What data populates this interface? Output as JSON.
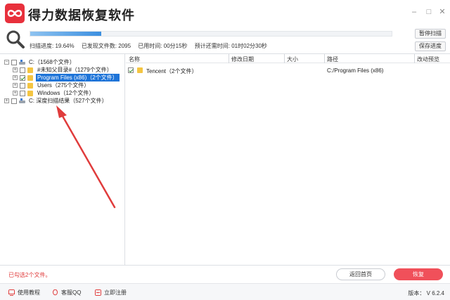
{
  "app": {
    "title": "得力数据恢复软件"
  },
  "window_controls": {
    "minimize": "–",
    "maximize": "□",
    "close": "✕"
  },
  "scan": {
    "progress_fraction": 0.1964,
    "progress_label": "扫描进度: 19.64%",
    "found_label": "已发现文件数: 2095",
    "elapsed_label": "已用时间: 00分15秒",
    "remaining_label": "预计还需时间: 01时02分30秒",
    "pause_button": "暂停扫描",
    "save_button": "保存进度"
  },
  "tree": {
    "items": [
      {
        "label": "C:（1568个文件）",
        "type": "drive",
        "checked": false,
        "selected": false
      },
      {
        "label": "#未知父目录#（1279个文件）",
        "type": "folder",
        "checked": false,
        "selected": false
      },
      {
        "label": "Program Files (x86)（2个文件）",
        "type": "folder",
        "checked": true,
        "selected": true
      },
      {
        "label": "Users（275个文件）",
        "type": "folder",
        "checked": false,
        "selected": false
      },
      {
        "label": "Windows（12个文件）",
        "type": "folder",
        "checked": false,
        "selected": false
      },
      {
        "label": "C: 深度扫描结果（527个文件）",
        "type": "drive",
        "checked": false,
        "selected": false
      }
    ]
  },
  "list": {
    "columns": [
      "名称",
      "修改日期",
      "大小",
      "路径",
      "改动预览"
    ],
    "rows": [
      {
        "name": "Tencent（2个文件）",
        "date": "",
        "size": "",
        "path": "C:/Program Files (x86)",
        "checked": true
      }
    ]
  },
  "status": {
    "selected_count": "已勾选2个文件。",
    "back_button": "返回首页",
    "recover_button": "恢复"
  },
  "footer": {
    "tutorial": "使用教程",
    "qq": "客服QQ",
    "register": "立即注册",
    "version": "版本： V 6.2.4"
  },
  "colors": {
    "brand": "#e8303c",
    "accent": "#1e74d8",
    "recover": "#f0505a",
    "arrow": "#e03c3c"
  }
}
